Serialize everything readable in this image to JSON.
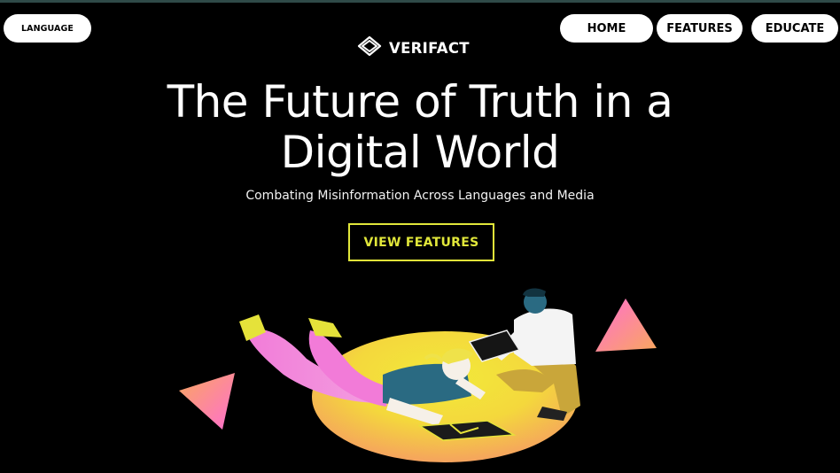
{
  "header": {
    "language_label": "LANGUAGE",
    "brand_name": "VERIFACT",
    "nav": [
      {
        "label": "HOME"
      },
      {
        "label": "FEATURES"
      },
      {
        "label": "EDUCATE"
      }
    ]
  },
  "hero": {
    "title_line1": "The Future of Truth in a",
    "title_line2": "Digital World",
    "subtitle": "Combating Misinformation Across Languages and Media",
    "cta_label": "VIEW FEATURES"
  },
  "colors": {
    "background": "#000000",
    "accent_yellow": "#e1e73a",
    "pill_bg": "#ffffff",
    "illustration_pink": "#f27bd8",
    "illustration_orange": "#f79a6a",
    "illustration_teal": "#2a6a82"
  },
  "icons": {
    "brand_logo": "rounded-diamond-logo-icon"
  }
}
